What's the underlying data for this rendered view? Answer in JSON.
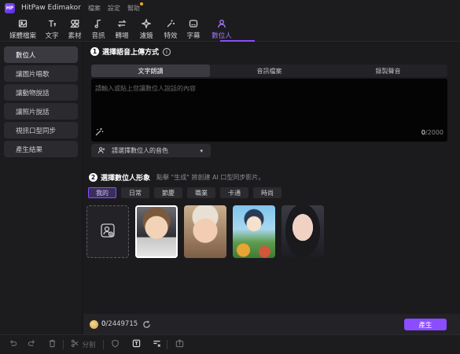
{
  "titlebar": {
    "logo_text": "HP",
    "app_name": "HitPaw Edimakor",
    "menus": [
      "檔案",
      "設定",
      "幫助"
    ]
  },
  "toolbar": {
    "tools": [
      {
        "label": "媒體檔案",
        "icon": "media-icon"
      },
      {
        "label": "文字",
        "icon": "text-icon"
      },
      {
        "label": "素材",
        "icon": "assets-icon"
      },
      {
        "label": "音訊",
        "icon": "music-icon"
      },
      {
        "label": "轉場",
        "icon": "transition-icon"
      },
      {
        "label": "濾鏡",
        "icon": "filter-icon"
      },
      {
        "label": "特效",
        "icon": "effects-icon"
      },
      {
        "label": "字幕",
        "icon": "subtitle-icon"
      },
      {
        "label": "數位人",
        "icon": "digital-human-icon"
      }
    ],
    "active_tool": "數位人"
  },
  "sidebar": {
    "items": [
      {
        "label": "數位人",
        "active": true
      },
      {
        "label": "讓圖片唱歌",
        "active": false
      },
      {
        "label": "讓動物說話",
        "active": false
      },
      {
        "label": "讓照片說話",
        "active": false
      },
      {
        "label": "視訊口型同步",
        "active": false
      },
      {
        "label": "產生結果",
        "active": false
      }
    ]
  },
  "step1": {
    "number": "1",
    "title": "選擇語音上傳方式",
    "tabs": [
      "文字朗讀",
      "音訊檔案",
      "錄製聲音"
    ],
    "active_tab": "文字朗讀",
    "placeholder": "請輸入或貼上您讓數位人說話的內容",
    "char_count": "0",
    "char_limit": "/2000",
    "voice_select_label": "請選擇數位人的音色"
  },
  "step2": {
    "number": "2",
    "title": "選擇數位人形象",
    "hint": "點擊 \"生成\" 將創建 AI 口型同步影片。",
    "filters": [
      "我的",
      "日常",
      "節慶",
      "職業",
      "卡通",
      "時尚"
    ],
    "active_filter": "我的",
    "avatars": [
      {
        "kind": "upload",
        "icon": "add-user-icon"
      },
      {
        "kind": "baby-headphones",
        "selected": true
      },
      {
        "kind": "baby-knit-hat",
        "selected": false
      },
      {
        "kind": "anime-boy",
        "selected": false
      },
      {
        "kind": "woman-portrait",
        "selected": false
      }
    ]
  },
  "footer": {
    "credits_used": "0",
    "credits_total": "/2449715",
    "generate_label": "產生"
  },
  "bottombar": {
    "split_label": "分割"
  },
  "colors": {
    "accent": "#8a4dff",
    "background": "#18181b",
    "panel": "#1c1c1f"
  }
}
